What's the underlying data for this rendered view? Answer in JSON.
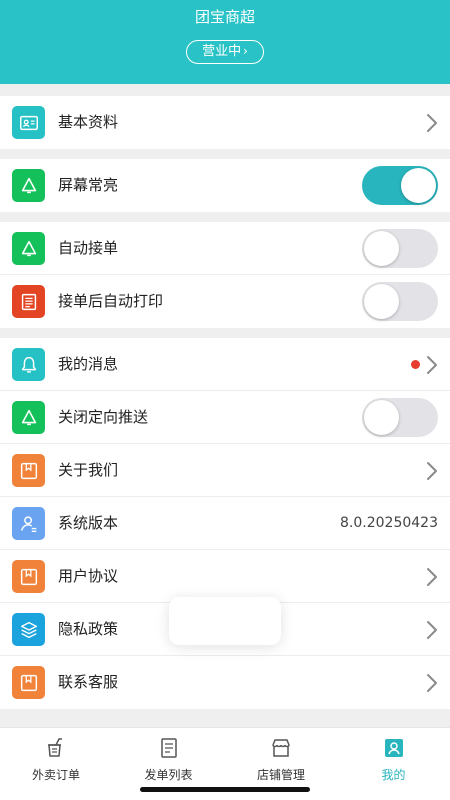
{
  "header": {
    "store_name": "团宝商超",
    "status_label": "营业中"
  },
  "colors": {
    "brand": "#29c3c7",
    "toggle_on": "#29b5bd",
    "badge": "#e63c2e"
  },
  "groups": [
    {
      "items": [
        {
          "label": "基本资料",
          "icon": "id-card-icon",
          "control": "chevron"
        }
      ]
    },
    {
      "items": [
        {
          "label": "屏幕常亮",
          "icon": "bell-icon",
          "control": "toggle",
          "toggle_on": true
        }
      ]
    },
    {
      "items": [
        {
          "label": "自动接单",
          "icon": "bell-icon",
          "control": "toggle",
          "toggle_on": false
        },
        {
          "label": "接单后自动打印",
          "icon": "printer-doc-icon",
          "control": "toggle",
          "toggle_on": false
        }
      ]
    },
    {
      "items": [
        {
          "label": "我的消息",
          "icon": "bell-icon",
          "control": "chevron",
          "badge": true
        },
        {
          "label": "关闭定向推送",
          "icon": "bell-icon",
          "control": "toggle",
          "toggle_on": false
        },
        {
          "label": "关于我们",
          "icon": "bookmark-icon",
          "control": "chevron"
        },
        {
          "label": "系统版本",
          "icon": "user-icon",
          "control": "value",
          "value": "8.0.20250423"
        },
        {
          "label": "用户协议",
          "icon": "bookmark-icon",
          "control": "chevron"
        },
        {
          "label": "隐私政策",
          "icon": "layers-icon",
          "control": "chevron"
        },
        {
          "label": "联系客服",
          "icon": "bookmark-icon",
          "control": "chevron"
        }
      ]
    }
  ],
  "tabs": [
    {
      "label": "外卖订单",
      "icon": "cup-icon",
      "active": false
    },
    {
      "label": "发单列表",
      "icon": "list-icon",
      "active": false
    },
    {
      "label": "店铺管理",
      "icon": "store-icon",
      "active": false
    },
    {
      "label": "我的",
      "icon": "profile-icon",
      "active": true
    }
  ]
}
